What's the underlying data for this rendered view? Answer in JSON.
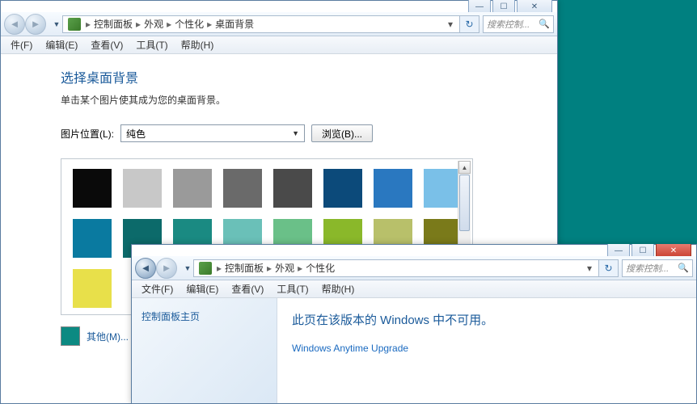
{
  "win1": {
    "breadcrumbs": [
      "控制面板",
      "外观",
      "个性化",
      "桌面背景"
    ],
    "search_placeholder": "搜索控制...",
    "menu": [
      "件(F)",
      "编辑(E)",
      "查看(V)",
      "工具(T)",
      "帮助(H)"
    ],
    "heading": "选择桌面背景",
    "subtitle": "单击某个图片使其成为您的桌面背景。",
    "loc_label": "图片位置(L):",
    "combo_value": "纯色",
    "browse_label": "浏览(B)...",
    "other_label": "其他(M)...",
    "other_color": "#0c8a82",
    "swatches": [
      [
        "#0a0a0a",
        "#c8c8c8",
        "#9a9a9a",
        "#6a6a6a",
        "#4a4a4a",
        "#0c4a7a",
        "#2a78c0",
        "#7ac0e8"
      ],
      [
        "#0a7aa0",
        "#0c6a6a",
        "#1a8a82",
        "#6ac0b8",
        "#6ac088",
        "#8ab82a",
        "#b8c06a",
        "#7a7a1a"
      ],
      [
        "#e8e04a"
      ]
    ]
  },
  "win2": {
    "breadcrumbs": [
      "控制面板",
      "外观",
      "个性化"
    ],
    "search_placeholder": "搜索控制...",
    "menu": [
      "文件(F)",
      "编辑(E)",
      "查看(V)",
      "工具(T)",
      "帮助(H)"
    ],
    "side_link": "控制面板主页",
    "message": "此页在该版本的 Windows 中不可用。",
    "upgrade_link": "Windows Anytime Upgrade"
  }
}
